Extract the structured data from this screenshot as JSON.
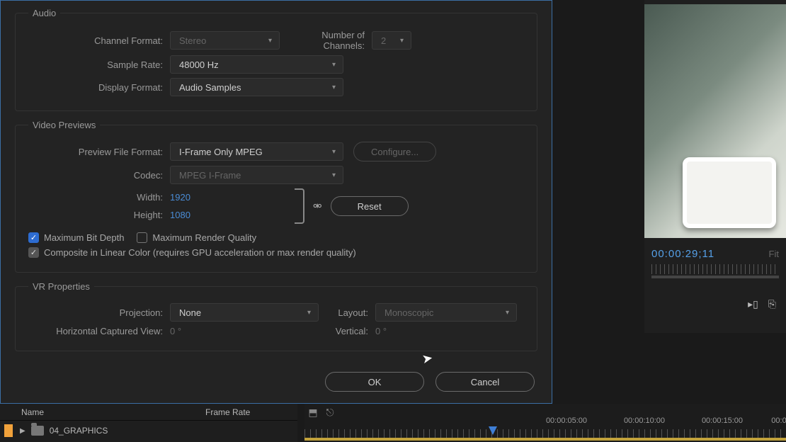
{
  "dialog": {
    "audio": {
      "legend": "Audio",
      "channel_format_label": "Channel Format:",
      "channel_format_value": "Stereo",
      "num_channels_label": "Number of Channels:",
      "num_channels_value": "2",
      "sample_rate_label": "Sample Rate:",
      "sample_rate_value": "48000 Hz",
      "display_format_label": "Display Format:",
      "display_format_value": "Audio Samples"
    },
    "previews": {
      "legend": "Video Previews",
      "format_label": "Preview File Format:",
      "format_value": "I-Frame Only MPEG",
      "configure_label": "Configure...",
      "codec_label": "Codec:",
      "codec_value": "MPEG I-Frame",
      "width_label": "Width:",
      "width_value": "1920",
      "height_label": "Height:",
      "height_value": "1080",
      "reset_label": "Reset",
      "max_bit_depth_label": "Maximum Bit Depth",
      "max_render_label": "Maximum Render Quality",
      "composite_label": "Composite in Linear Color (requires GPU acceleration or max render quality)"
    },
    "vr": {
      "legend": "VR Properties",
      "projection_label": "Projection:",
      "projection_value": "None",
      "layout_label": "Layout:",
      "layout_value": "Monoscopic",
      "hview_label": "Horizontal Captured View:",
      "hview_value": "0 °",
      "vview_label": "Vertical:",
      "vview_value": "0 °"
    },
    "ok_label": "OK",
    "cancel_label": "Cancel"
  },
  "project": {
    "col_name": "Name",
    "col_rate": "Frame Rate",
    "item_name": "04_GRAPHICS"
  },
  "timeline": {
    "labels": [
      "00:00:05:00",
      "00:00:10:00",
      "00:00:15:00",
      "00:0"
    ]
  },
  "monitor": {
    "timecode": "00:00:29;11",
    "fit": "Fit"
  }
}
